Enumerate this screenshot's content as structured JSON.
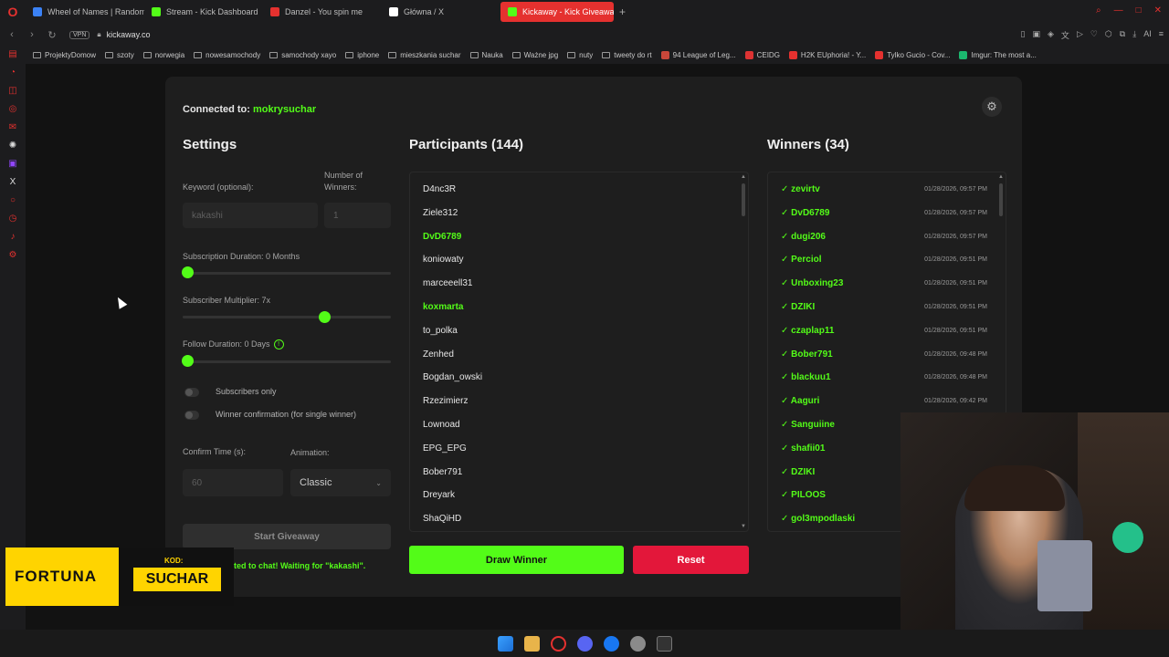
{
  "browser": {
    "tabs": [
      {
        "label": "Wheel of Names | Random",
        "color": "#3b82f6"
      },
      {
        "label": "Stream - Kick Dashboard",
        "color": "#53fc18"
      },
      {
        "label": "Danzel - You spin me",
        "color": "#e5312f"
      },
      {
        "label": "Główna / X",
        "color": "#ffffff"
      },
      {
        "label": "Kickaway - Kick Giveaway",
        "color": "#53fc18"
      }
    ],
    "new_tab": "+",
    "vpn": "VPN",
    "url": "kickaway.co",
    "ai_label": "AI",
    "bookmarks": [
      "ProjektyDomow",
      "szoty",
      "norwegia",
      "nowesamochody",
      "samochody xayo",
      "iphone",
      "mieszkania suchar",
      "Nauka",
      "Ważne jpg",
      "nuty",
      "tweety do rt",
      "94 League of Leg...",
      "CEIDG",
      "H2K EUphoria! - Y...",
      "Tylko Gucio - Cov...",
      "Imgur: The most a..."
    ]
  },
  "app": {
    "connected_label": "Connected to:",
    "connected_user": "mokrysuchar",
    "settings": {
      "title": "Settings",
      "keyword_label": "Keyword (optional):",
      "keyword_value": "kakashi",
      "winners_label": "Number of Winners:",
      "winners_value": "1",
      "subscription_label": "Subscription Duration: 0 Months",
      "subscription_fraction": 0.0,
      "multiplier_label": "Subscriber Multiplier: 7x",
      "multiplier_fraction": 0.66,
      "follow_label": "Follow Duration:  0  Days",
      "follow_info": "!",
      "follow_fraction": 0.0,
      "subscribers_only": "Subscribers only",
      "winner_confirmation": "Winner confirmation (for single winner)",
      "confirm_time_label": "Confirm Time (s):",
      "confirm_time_value": "60",
      "animation_label": "Animation:",
      "animation_value": "Classic",
      "start_button": "Start Giveaway",
      "status": "ted to chat! Waiting for \"kakashi\"."
    },
    "participants": {
      "title": "Participants (144)",
      "rows": [
        {
          "name": "D4nc3R",
          "sub": false
        },
        {
          "name": "Ziele312",
          "sub": false
        },
        {
          "name": "DvD6789",
          "sub": true
        },
        {
          "name": "koniowaty",
          "sub": false
        },
        {
          "name": "marceeell31",
          "sub": false
        },
        {
          "name": "koxmarta",
          "sub": true
        },
        {
          "name": "to_polka",
          "sub": false
        },
        {
          "name": "Zenhed",
          "sub": false
        },
        {
          "name": "Bogdan_owski",
          "sub": false
        },
        {
          "name": "Rzezimierz",
          "sub": false
        },
        {
          "name": "Lownoad",
          "sub": false
        },
        {
          "name": "EPG_EPG",
          "sub": false
        },
        {
          "name": "Bober791",
          "sub": false
        },
        {
          "name": "Dreyark",
          "sub": false
        },
        {
          "name": "ShaQiHD",
          "sub": false
        }
      ],
      "draw_button": "Draw Winner",
      "reset_button": "Reset"
    },
    "winners": {
      "title": "Winners (34)",
      "rows": [
        {
          "name": "✓ zevirtv",
          "date": "01/28/2026, 09:57 PM"
        },
        {
          "name": "✓ DvD6789",
          "date": "01/28/2026, 09:57 PM"
        },
        {
          "name": "✓ dugi206",
          "date": "01/28/2026, 09:57 PM"
        },
        {
          "name": "✓ Perciol",
          "date": "01/28/2026, 09:51 PM"
        },
        {
          "name": "✓ Unboxing23",
          "date": "01/28/2026, 09:51 PM"
        },
        {
          "name": "✓ DZIKI",
          "date": "01/28/2026, 09:51 PM"
        },
        {
          "name": "✓ czaplap11",
          "date": "01/28/2026, 09:51 PM"
        },
        {
          "name": "✓ Bober791",
          "date": "01/28/2026, 09:48 PM"
        },
        {
          "name": "✓ blackuu1",
          "date": "01/28/2026, 09:48 PM"
        },
        {
          "name": "✓ Aaguri",
          "date": "01/28/2026, 09:42 PM"
        },
        {
          "name": "✓ Sanguiine",
          "date": ""
        },
        {
          "name": "✓ shafii01",
          "date": ""
        },
        {
          "name": "✓ DZIKI",
          "date": ""
        },
        {
          "name": "✓ PILOOS",
          "date": ""
        },
        {
          "name": "✓ gol3mpodlaski",
          "date": ""
        }
      ]
    }
  },
  "overlay": {
    "brand": "FORTUNA",
    "kod_label": "KOD:",
    "code": "SUCHAR"
  },
  "colors": {
    "accent_green": "#53fc18",
    "reset_red": "#e3173a",
    "opera_red": "#e5312f"
  }
}
